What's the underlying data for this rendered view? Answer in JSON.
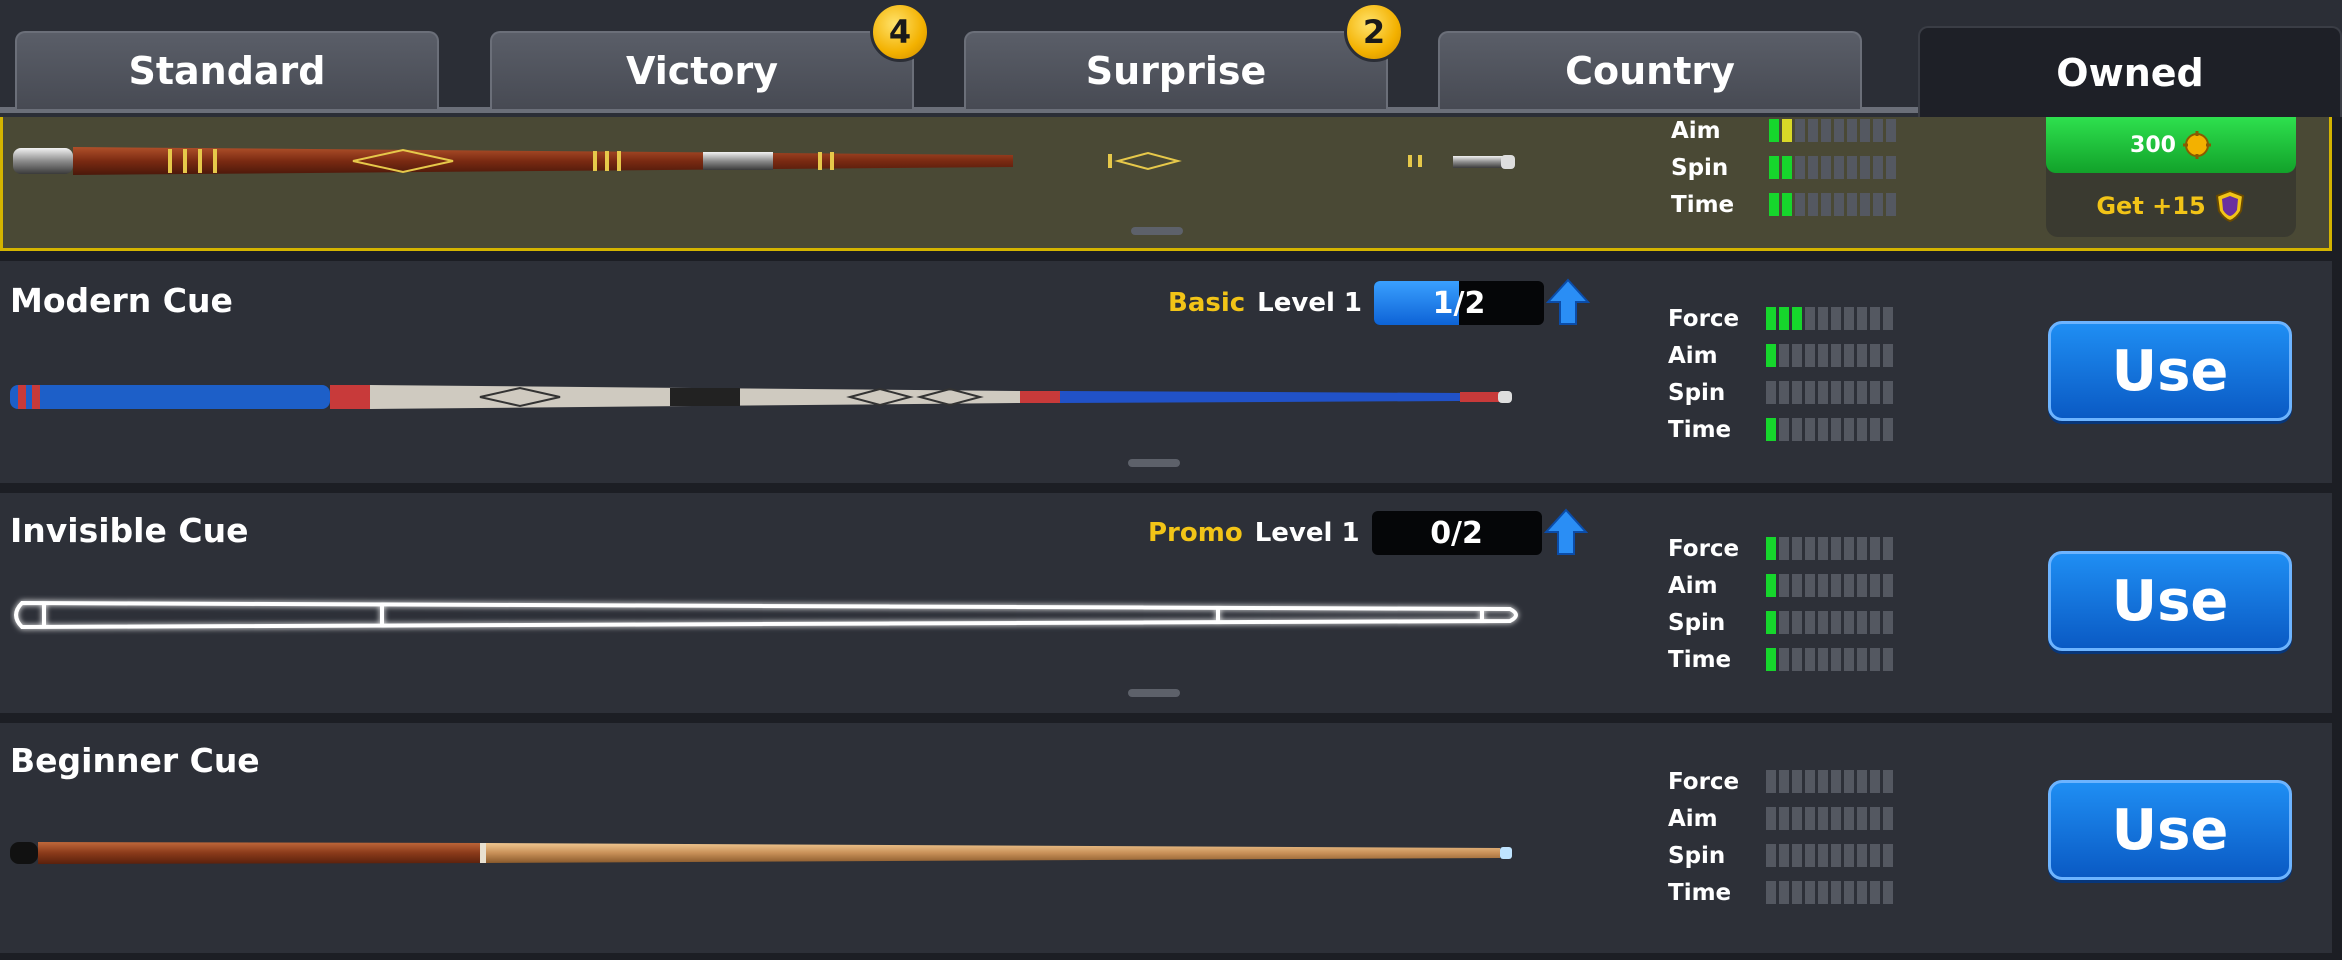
{
  "tabs": [
    {
      "label": "Standard",
      "badge": null
    },
    {
      "label": "Victory",
      "badge": "4"
    },
    {
      "label": "Surprise",
      "badge": "2"
    },
    {
      "label": "Country",
      "badge": null
    },
    {
      "label": "Owned",
      "badge": null,
      "active": true
    }
  ],
  "top_row": {
    "stats": [
      {
        "label": "Aim",
        "filled": 2,
        "color": "mixed"
      },
      {
        "label": "Spin",
        "filled": 2
      },
      {
        "label": "Time",
        "filled": 2
      }
    ],
    "price": "300",
    "get_bonus": "Get +15"
  },
  "cues": [
    {
      "name": "Modern Cue",
      "level_type": "Basic",
      "level_text": "Level 1",
      "progress": "1/2",
      "progress_fraction": 0.5,
      "stats": [
        {
          "label": "Force",
          "filled": 3
        },
        {
          "label": "Aim",
          "filled": 1
        },
        {
          "label": "Spin",
          "filled": 0
        },
        {
          "label": "Time",
          "filled": 1
        }
      ],
      "action": "Use"
    },
    {
      "name": "Invisible Cue",
      "level_type": "Promo",
      "level_text": "Level 1",
      "progress": "0/2",
      "progress_fraction": 0,
      "stats": [
        {
          "label": "Force",
          "filled": 1
        },
        {
          "label": "Aim",
          "filled": 1
        },
        {
          "label": "Spin",
          "filled": 1
        },
        {
          "label": "Time",
          "filled": 1
        }
      ],
      "action": "Use"
    },
    {
      "name": "Beginner Cue",
      "level_type": "",
      "level_text": "",
      "progress": "",
      "stats": [
        {
          "label": "Force",
          "filled": 0
        },
        {
          "label": "Aim",
          "filled": 0
        },
        {
          "label": "Spin",
          "filled": 0
        },
        {
          "label": "Time",
          "filled": 0
        }
      ],
      "action": "Use"
    }
  ],
  "colors": {
    "accent_blue": "#1f8ef3",
    "stat_on": "#16d62c",
    "level_gold": "#f2c417",
    "selected_border": "#d4b400"
  }
}
